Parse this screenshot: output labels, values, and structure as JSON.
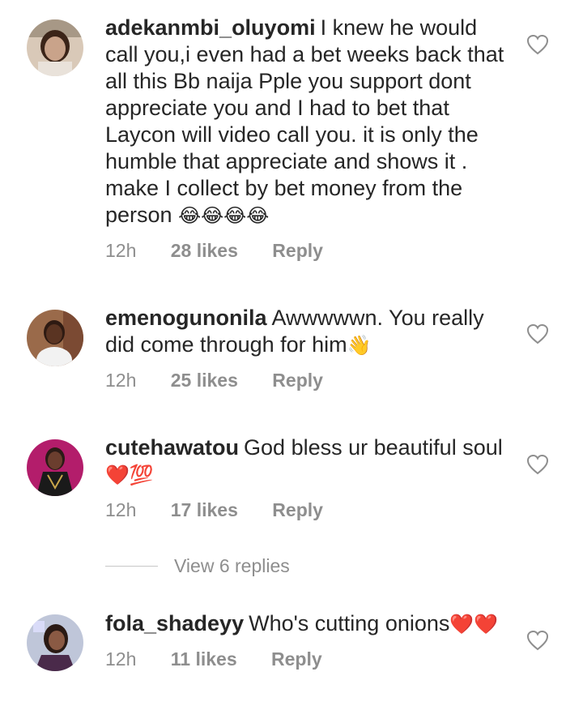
{
  "comments": [
    {
      "username": "adekanmbi_oluyomi",
      "text": "I knew he would call you,i even had a bet weeks back that all this Bb naija Pple you support dont appreciate you and I had to bet that Laycon will video call you. it is only the humble that appreciate and shows it . make I collect by bet money from the person",
      "emoji": "😂😂😂😂",
      "time": "12h",
      "likes": "28 likes",
      "reply": "Reply",
      "avatar_colors": [
        "#d9c9b8",
        "#3b2418",
        "#c9a38a"
      ]
    },
    {
      "username": "emenogunonila",
      "text": "Awwwwwn. You really did come through for him",
      "emoji": "👋",
      "time": "12h",
      "likes": "25 likes",
      "reply": "Reply",
      "avatar_colors": [
        "#9a6a4a",
        "#2e1a12",
        "#f2f2f2"
      ]
    },
    {
      "username": "cutehawatou",
      "text": "God bless ur beautiful soul",
      "emoji": "❤️💯",
      "time": "12h",
      "likes": "17 likes",
      "reply": "Reply",
      "avatar_colors": [
        "#b31d6b",
        "#2b1b16",
        "#1a1a1a"
      ]
    },
    {
      "username": "fola_shadeyy",
      "text": "Who's cutting onions",
      "emoji": "❤️❤️",
      "time": "12h",
      "likes": "11 likes",
      "reply": "Reply",
      "avatar_colors": [
        "#bfc6d9",
        "#2a1a14",
        "#e0e0ff"
      ]
    }
  ],
  "view_replies": "View 6 replies",
  "colors": {
    "text": "#262626",
    "meta": "#8e8e8e",
    "heart_outline": "#8e8e8e",
    "emoji_heart": "#e0202a"
  }
}
